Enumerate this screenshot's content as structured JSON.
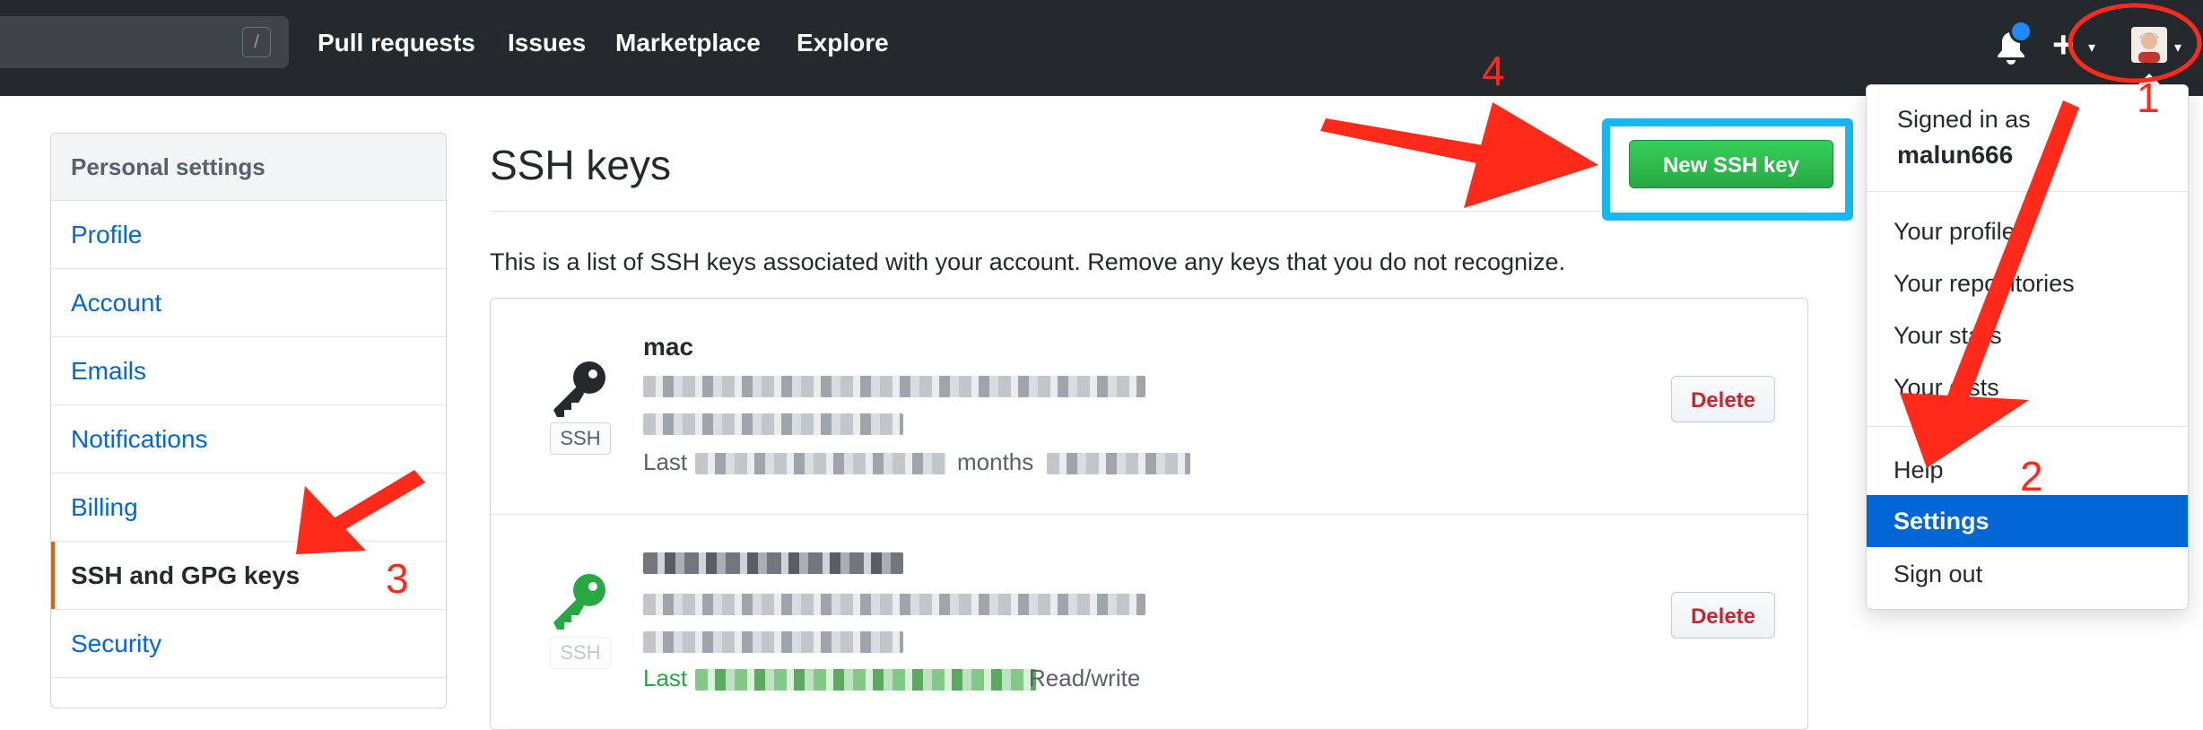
{
  "header": {
    "search_shortcut": "/",
    "nav": [
      "Pull requests",
      "Issues",
      "Marketplace",
      "Explore"
    ],
    "plus_symbol": "+",
    "caret_symbol": "▾"
  },
  "sidebar": {
    "heading": "Personal settings",
    "items": [
      {
        "label": "Profile"
      },
      {
        "label": "Account"
      },
      {
        "label": "Emails"
      },
      {
        "label": "Notifications"
      },
      {
        "label": "Billing"
      },
      {
        "label": "SSH and GPG keys"
      },
      {
        "label": "Security"
      }
    ],
    "selected_item": "SSH and GPG keys"
  },
  "main": {
    "title": "SSH keys",
    "new_key_button": "New SSH key",
    "intro": "This is a list of SSH keys associated with your account. Remove any keys that you do not recognize.",
    "keys": [
      {
        "title": "mac",
        "badge": "SSH",
        "last_used_prefix": "Last",
        "last_used_suffix": "months",
        "delete_label": "Delete",
        "icon": "key-icon",
        "icon_color": "#24292e"
      },
      {
        "badge": "SSH",
        "last_used_prefix": "Last",
        "access": "Read/write",
        "delete_label": "Delete",
        "icon": "key-icon",
        "icon_color": "#28a745"
      }
    ]
  },
  "dropdown": {
    "signed_in_as": "Signed in as",
    "username": "malun666",
    "items": [
      "Your profile",
      "Your repositories",
      "Your stars",
      "Your gists",
      "Help",
      "Settings",
      "Sign out"
    ],
    "active_item": "Settings"
  },
  "annotations": {
    "step1": "1",
    "step2": "2",
    "step3": "3",
    "step4": "4",
    "color": "#ff2a1a",
    "highlight_color": "#15b8f0"
  }
}
